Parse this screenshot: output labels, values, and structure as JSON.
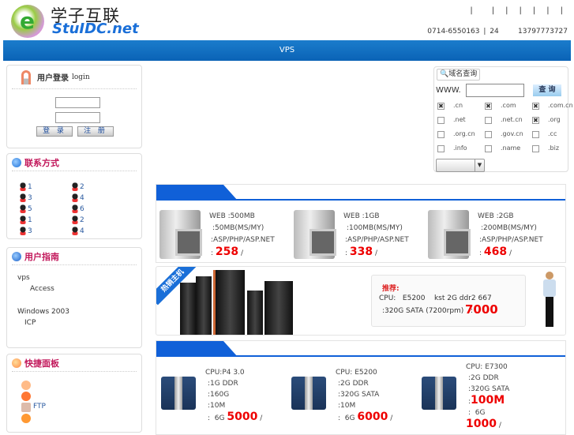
{
  "header": {
    "logo_cn": "学子互联",
    "logo_en": "StuIDC.net",
    "top_links": [
      "|",
      "|",
      "|",
      "|",
      "|",
      "|",
      "|"
    ],
    "phone": "0714-6550163 | 24     13797773727"
  },
  "nav": {
    "title": "VPS"
  },
  "login": {
    "title": "用户登录",
    "title_en": "login",
    "login_button": "登 录",
    "register_button": "注 册"
  },
  "contact": {
    "title": "联系方式",
    "qq": [
      "1",
      "2",
      "3",
      "4",
      "5",
      "6",
      "1",
      "2",
      "3",
      "4"
    ]
  },
  "guide": {
    "title": "用户指南",
    "items": [
      "vps",
      "Access",
      "Windows 2003",
      "ICP"
    ]
  },
  "quick": {
    "title": "快捷面板",
    "items": [
      "",
      "",
      "FTP",
      ""
    ]
  },
  "domain": {
    "tab": "域名查询",
    "prefix": "WWW.",
    "search_button": "查 询",
    "input_value": "",
    "select_value": "",
    "extensions": [
      {
        "name": ".cn",
        "checked": true
      },
      {
        "name": ".com",
        "checked": true
      },
      {
        "name": ".com.cn",
        "checked": true
      },
      {
        "name": ".net",
        "checked": false
      },
      {
        "name": ".net.cn",
        "checked": false
      },
      {
        "name": ".org",
        "checked": true
      },
      {
        "name": ".org.cn",
        "checked": false
      },
      {
        "name": ".gov.cn",
        "checked": false
      },
      {
        "name": ".cc",
        "checked": false
      },
      {
        "name": ".info",
        "checked": false
      },
      {
        "name": ".name",
        "checked": false
      },
      {
        "name": ".biz",
        "checked": false
      }
    ]
  },
  "hosting": [
    {
      "l1": "WEB  :500MB",
      "l2": ":50MB(MS/MY)",
      "l3": ":ASP/PHP/ASP.NET",
      "pre": ":",
      "price": "258",
      "suf": "/"
    },
    {
      "l1": "WEB  :1GB",
      "l2": ":100MB(MS/MY)",
      "l3": ":ASP/PHP/ASP.NET",
      "pre": ":",
      "price": "338",
      "suf": "/"
    },
    {
      "l1": "WEB  :2GB",
      "l2": ":200MB(MS/MY)",
      "l3": ":ASP/PHP/ASP.NET",
      "pre": ":",
      "price": "468",
      "suf": "/"
    }
  ],
  "hot": {
    "ribbon": "热销主机",
    "rec_title": "推荐:",
    "rec_l1": "CPU:   E5200    kst 2G ddr2 667",
    "rec_l2": ":320G SATA (7200rpm)   :",
    "rec_price": "7000"
  },
  "servers": [
    {
      "l1": "CPU:P4 3.0",
      "l2": ":1G DDR",
      "l3": ":160G",
      "l4": ":10M",
      "pre": ":  6G",
      "price": "5000",
      "suf": "/"
    },
    {
      "l1": "CPU:  E5200",
      "l2": ":2G DDR",
      "l3": ":320G SATA",
      "l4": ":10M",
      "pre": ":  6G",
      "price": "6000",
      "suf": "/"
    },
    {
      "l1": "CPU:    E7300",
      "l2": ":2G DDR",
      "l3": ":320G SATA",
      "l4": ":",
      "l4b": "100M",
      "pre": ":  6G",
      "price": "1000",
      "suf": "/"
    }
  ]
}
